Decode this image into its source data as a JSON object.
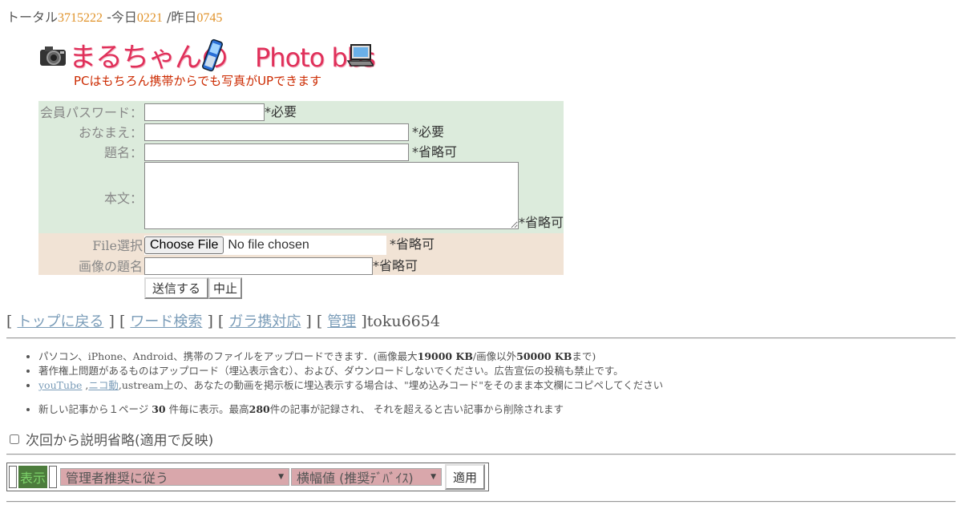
{
  "counter": {
    "total_label": "トータル",
    "total": "3715222",
    "today_label": " -今日",
    "today": "0221",
    "yesterday_label": " /昨日",
    "yesterday": "0745"
  },
  "logo": {
    "title_jp": "まるちゃんの",
    "title_en": "Photo bbs",
    "subtitle": "PCはもちろん携帯からでも写真がUPできます"
  },
  "form": {
    "password_label": "会員パスワード：",
    "password_note": "*必要",
    "name_label": "おなまえ：",
    "name_note": "*必要",
    "subject_label": "題名：",
    "subject_note": "*省略可",
    "body_label": "本文：",
    "body_note": "*省略可",
    "file_label": "File選択",
    "file_button": "Choose File",
    "file_status": "No file chosen",
    "file_note": "*省略可",
    "image_title_label": "画像の題名",
    "image_title_note": "*省略可",
    "submit_label": "送信する",
    "cancel_label": "中止"
  },
  "nav": {
    "open1": "[ ",
    "top": "トップに戻る",
    "sep1": " ] [ ",
    "word_search": "ワード検索",
    "sep2": " ] [ ",
    "mobile": "ガラ携対応",
    "sep3": " ] [ ",
    "admin": "管理",
    "close": " ]toku6654"
  },
  "info": {
    "line1_a": "パソコン、iPhone、Android、携帯のファイルをアップロードできます．(画像最大",
    "line1_b": "19000 KB",
    "line1_c": "/画像以外",
    "line1_d": "50000 KB",
    "line1_e": "まで)",
    "line2": "著作権上問題があるものはアップロード（埋込表示含む）、および、ダウンロードしないでください。広告宣伝の投稿も禁止です。",
    "line3_link1": "youTube",
    "line3_sep": " ,",
    "line3_link2": "ニコ動",
    "line3_rest": ",ustream上の、あなたの動画を掲示板に埋込表示する場合は、\"埋め込みコード\"をそのまま本文欄にコピペしてください",
    "line4_a": "新しい記事から１ページ ",
    "line4_b": "30",
    "line4_c": " 件毎に表示。最高",
    "line4_d": "280",
    "line4_e": "件の記事が記録され、 それを超えると古い記事から削除されます"
  },
  "skip_label": "次回から説明省略(適用で反映)",
  "toolbar": {
    "view_label": "表示",
    "select1": "管理者推奨に従う",
    "select2": "横幅値 (推奨ﾃﾞﾊﾞｲｽ)",
    "apply_label": "適用"
  }
}
